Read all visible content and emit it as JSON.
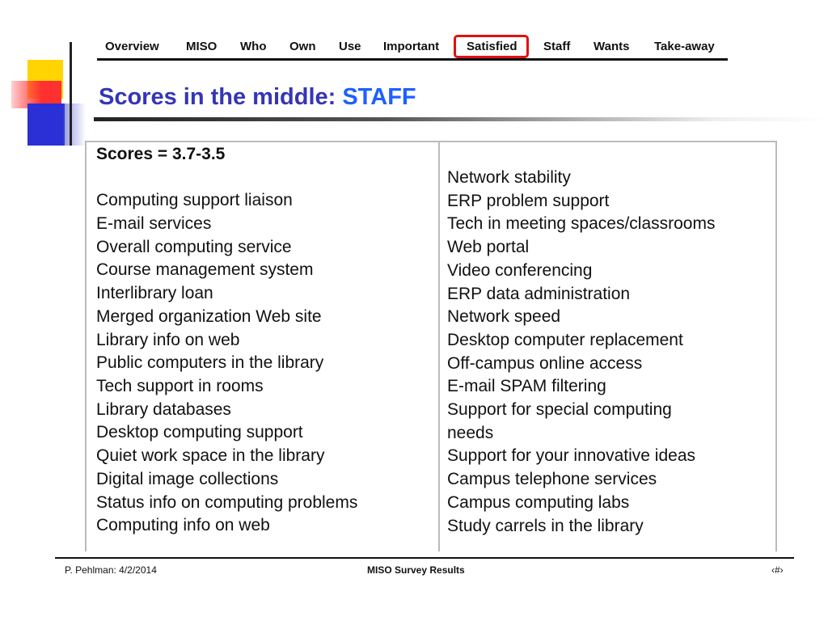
{
  "nav": {
    "items": [
      "Overview",
      "MISO",
      "Who",
      "Own",
      "Use",
      "Important",
      "Satisfied",
      "Staff",
      "Wants",
      "Take-away"
    ],
    "active": "Satisfied",
    "highlight_color": "#e01010"
  },
  "title": {
    "main": "Scores in the middle: ",
    "accent": "STAFF"
  },
  "table": {
    "heading": "Scores = 3.7-3.5",
    "left_items": [
      "Computing support liaison",
      "E-mail services",
      "Overall computing service",
      "Course management system",
      "Interlibrary loan",
      "Merged organization Web site",
      "Library info on web",
      "Public computers in the library",
      "Tech support in rooms",
      "Library databases",
      "Desktop computing support",
      "Quiet work space in the library",
      "Digital image collections",
      "Status info on computing problems",
      "Computing info on web"
    ],
    "right_items": [
      "Network stability",
      "ERP problem support",
      "Tech in meeting spaces/classrooms",
      "Web portal",
      "Video conferencing",
      "ERP data administration",
      "Network speed",
      "Desktop computer replacement",
      "Off-campus online access",
      "E-mail SPAM filtering",
      "Support for special computing",
      "needs",
      "Support for your innovative ideas",
      "Campus telephone services",
      "Campus computing labs",
      "Study carrels in the library"
    ]
  },
  "footer": {
    "left": "P. Pehlman: 4/2/2014",
    "center": "MISO Survey Results",
    "right": "‹#›"
  },
  "colors": {
    "title": "#3535b8",
    "title_accent": "#1e60ff",
    "deco_yellow": "#ffd400",
    "deco_red": "#ff3030",
    "deco_blue": "#2b2fd6"
  }
}
